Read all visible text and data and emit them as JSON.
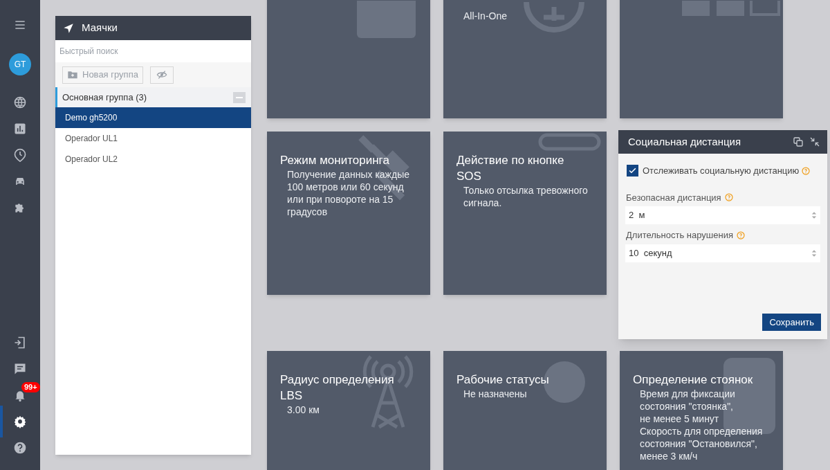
{
  "sidebar": {
    "avatar": "GT",
    "top_items": [
      {
        "selected": false
      },
      {
        "selected": false
      },
      {
        "selected": false
      },
      {
        "selected": false
      },
      {
        "selected": false
      }
    ],
    "bottom_items": [
      {
        "selected": false
      },
      {
        "selected": false
      },
      {
        "selected": false,
        "badge": "99+"
      },
      {
        "selected": true
      },
      {
        "selected": false
      }
    ]
  },
  "trackers": {
    "title": "Маячки",
    "search": {
      "placeholder": "Быстрый поиск"
    },
    "new_group_button": "Новая группа",
    "group": {
      "label": "Основная группа (3)",
      "expanded": true
    },
    "items": [
      {
        "label": "Demo gh5200",
        "selected": true
      },
      {
        "label": "Operador UL1",
        "selected": false
      },
      {
        "label": "Operador UL2",
        "selected": false
      }
    ]
  },
  "cards": [
    [
      {
        "kind": "blank"
      },
      {
        "kind": "info",
        "lines": [
          "All-In-One"
        ]
      },
      {
        "kind": "blank"
      }
    ],
    [
      {
        "kind": "info",
        "title": "Режим мониторинга",
        "lines": [
          "Получение данных каждые 100 метров или 60 секунд или при повороте на 15 градусов"
        ]
      },
      {
        "kind": "info",
        "title": "Действие по кнопке SOS",
        "lines": [
          "Только отсылка тревожного сигнала."
        ]
      }
    ],
    [
      {
        "kind": "info",
        "title": "Радиус определения LBS",
        "lines": [
          "3.00 км"
        ]
      },
      {
        "kind": "info",
        "title": "Рабочие статусы",
        "lines": [
          "Не назначены"
        ]
      },
      {
        "kind": "info",
        "title": "Определение стоянок",
        "lines": [
          "Время для фиксации состояния \"стоянка\",",
          "не менее 5 минут",
          "Скорость для определения состояния \"Остановился\", менее 3 км/ч"
        ]
      }
    ]
  ],
  "social_distance": {
    "title": "Социальная дистанция",
    "checkbox": {
      "label": "Отслеживать социальную дистанцию",
      "checked": true
    },
    "fields": [
      {
        "label": "Безопасная дистанция",
        "value": "2  м"
      },
      {
        "label": "Длительность нарушения",
        "value": "10  секунд"
      }
    ],
    "save_button": "Сохранить"
  }
}
